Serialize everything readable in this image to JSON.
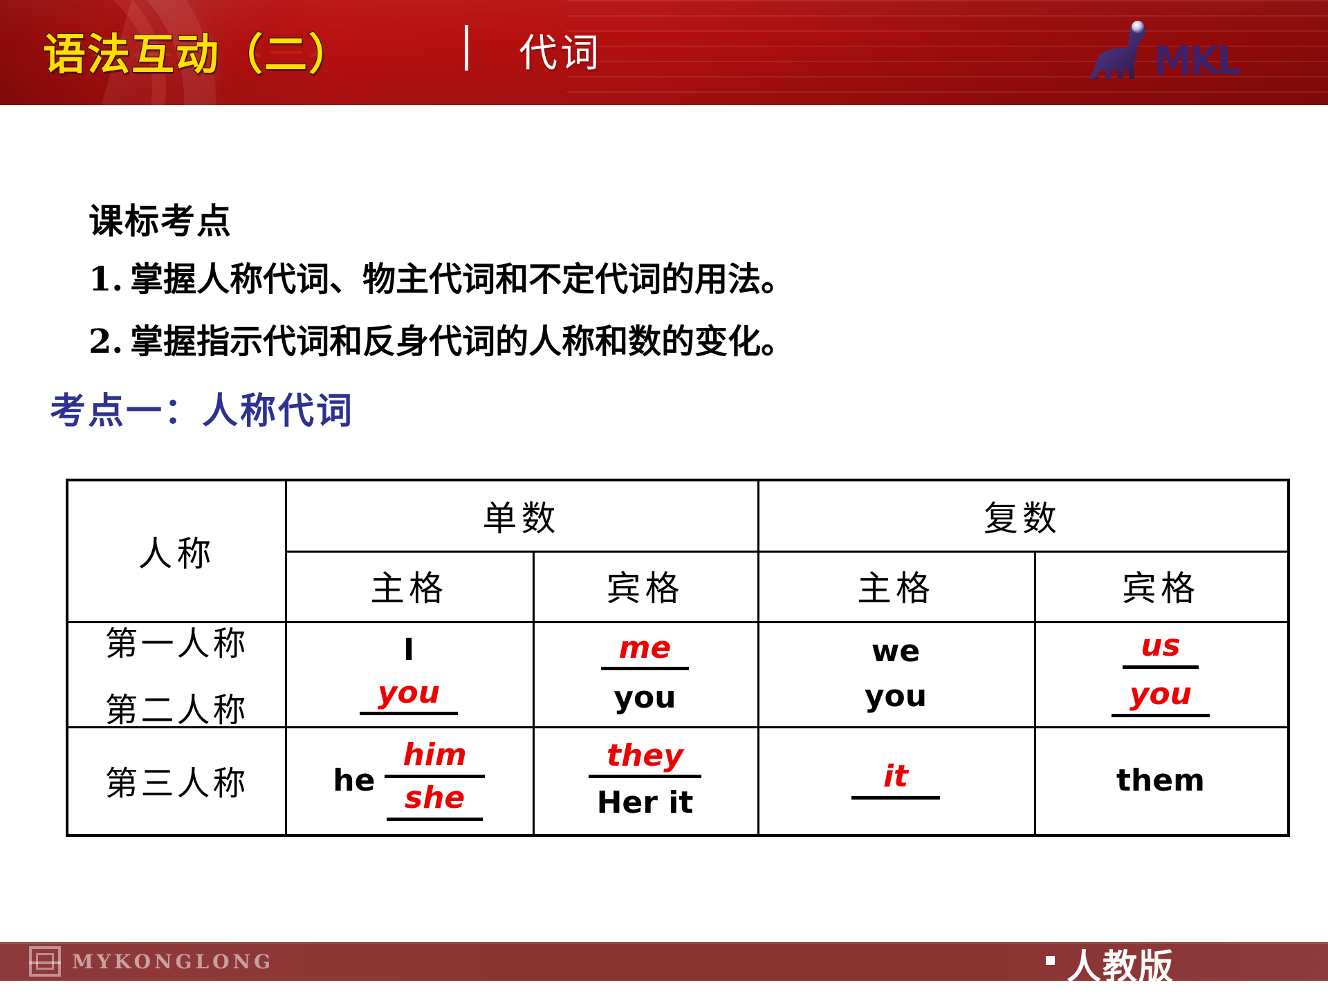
{
  "header": {
    "title_main": "语法互动（二）",
    "separator": "|",
    "title_sub": "代词",
    "logo": {
      "icon": "dinosaur-icon",
      "wordmark": "MKL"
    }
  },
  "body": {
    "standards_heading": "课标考点",
    "standards_items": [
      {
        "num": "1.",
        "text": "掌握人称代词、物主代词和不定代词的用法。"
      },
      {
        "num": "2.",
        "text": "掌握指示代词和反身代词的人称和数的变化。"
      }
    ],
    "focus_heading": "考点一：人称代词"
  },
  "table": {
    "corner_label": "人称",
    "group_headers": [
      "单数",
      "复数"
    ],
    "case_headers": [
      "主格",
      "宾格",
      "主格",
      "宾格"
    ],
    "rows": [
      {
        "person_labels": [
          "第一人称",
          "第二人称"
        ],
        "cells": {
          "singular_subject": [
            {
              "text": "I",
              "color": "#000000",
              "style": "plain",
              "underline": false
            },
            {
              "text": "you",
              "color": "#ee0000",
              "style": "answer",
              "underline": true
            }
          ],
          "singular_object": [
            {
              "text": "me",
              "color": "#ee0000",
              "style": "answer",
              "underline": true
            },
            {
              "text": "you",
              "color": "#000000",
              "style": "plain",
              "underline": false
            }
          ],
          "plural_subject": [
            {
              "text": "we",
              "color": "#000000",
              "style": "plain",
              "underline": false
            },
            {
              "text": "you",
              "color": "#000000",
              "style": "plain",
              "underline": false
            }
          ],
          "plural_object": [
            {
              "text": "us",
              "color": "#ee0000",
              "style": "answer",
              "underline": true
            },
            {
              "text": "you",
              "color": "#ee0000",
              "style": "answer",
              "underline": true
            }
          ]
        }
      },
      {
        "person_labels": [
          "第三人称"
        ],
        "cells": {
          "singular_subject_prefix": "he",
          "singular_subject": [
            {
              "text": "him",
              "color": "#ee0000",
              "style": "answer",
              "underline": true
            },
            {
              "text": "she",
              "color": "#ee0000",
              "style": "answer",
              "underline": true
            }
          ],
          "singular_object": [
            {
              "text": "they",
              "color": "#ee0000",
              "style": "answer",
              "underline": true
            },
            {
              "text": "Her  it",
              "color": "#000000",
              "style": "plain",
              "underline": false
            }
          ],
          "plural_subject": [
            {
              "text": "it",
              "color": "#ee0000",
              "style": "answer",
              "underline": true
            }
          ],
          "plural_object": [
            {
              "text": "them",
              "color": "#000000",
              "style": "plain",
              "underline": false
            }
          ]
        }
      }
    ]
  },
  "footer": {
    "logo_icon": "mykonglong-mark-icon",
    "brand": "MYKONGLONG",
    "edition_bullet": "·",
    "edition": "人教版"
  },
  "colors": {
    "header_red": "#b31010",
    "footer_red": "#8b3434",
    "title_yellow": "#ffe000",
    "focus_blue": "#2e3192",
    "answer_red": "#ee0000"
  }
}
